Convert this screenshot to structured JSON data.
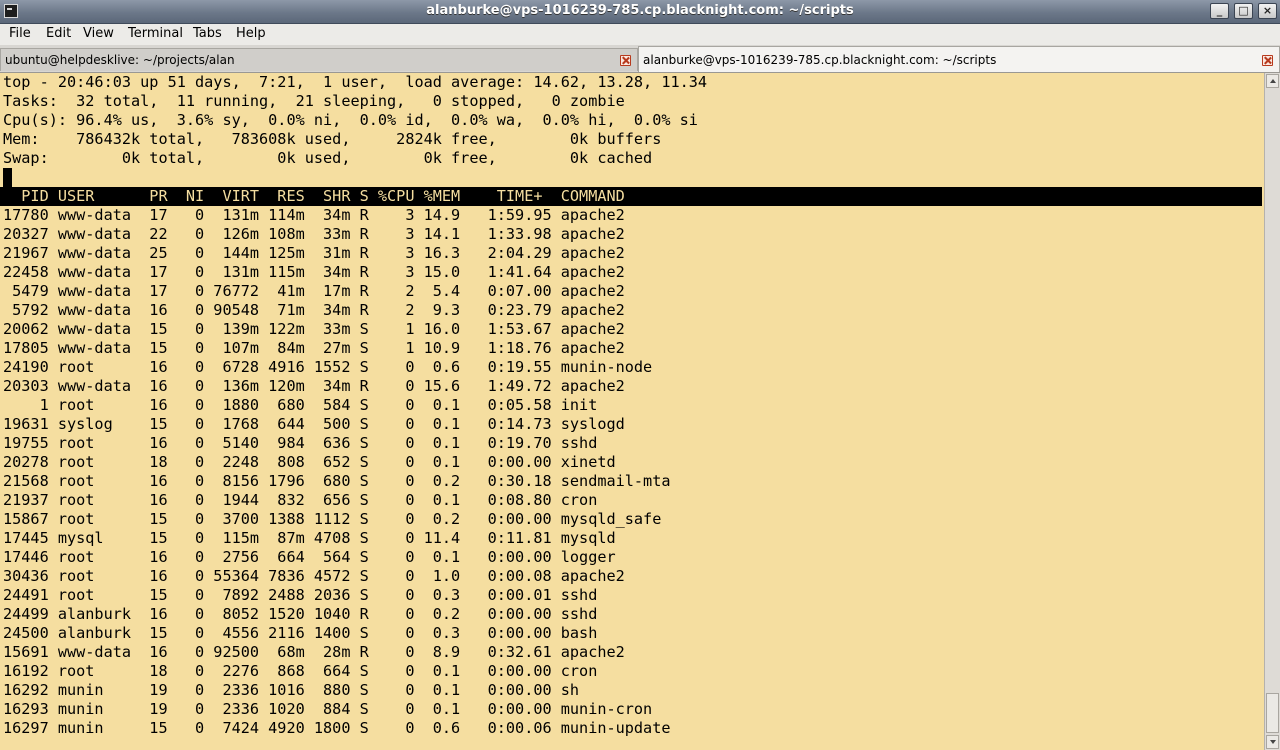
{
  "window": {
    "title": "alanburke@vps-1016239-785.cp.blacknight.com: ~/scripts",
    "minimize_label": "_",
    "maximize_label": "□",
    "close_label": "×"
  },
  "menu": [
    "File",
    "Edit",
    "View",
    "Terminal",
    "Tabs",
    "Help"
  ],
  "tabs": [
    {
      "label": "ubuntu@helpdesklive: ~/projects/alan",
      "active": false
    },
    {
      "label": "alanburke@vps-1016239-785.cp.blacknight.com: ~/scripts",
      "active": true
    }
  ],
  "summary": [
    "top - 20:46:03 up 51 days,  7:21,  1 user,  load average: 14.62, 13.28, 11.34",
    "Tasks:  32 total,  11 running,  21 sleeping,   0 stopped,   0 zombie",
    "Cpu(s): 96.4% us,  3.6% sy,  0.0% ni,  0.0% id,  0.0% wa,  0.0% hi,  0.0% si",
    "Mem:    786432k total,   783608k used,     2824k free,        0k buffers",
    "Swap:        0k total,        0k used,        0k free,        0k cached"
  ],
  "table_header": "  PID USER      PR  NI  VIRT  RES  SHR S %CPU %MEM    TIME+  COMMAND",
  "processes": [
    "17780 www-data  17   0  131m 114m  34m R    3 14.9   1:59.95 apache2",
    "20327 www-data  22   0  126m 108m  33m R    3 14.1   1:33.98 apache2",
    "21967 www-data  25   0  144m 125m  31m R    3 16.3   2:04.29 apache2",
    "22458 www-data  17   0  131m 115m  34m R    3 15.0   1:41.64 apache2",
    " 5479 www-data  17   0 76772  41m  17m R    2  5.4   0:07.00 apache2",
    " 5792 www-data  16   0 90548  71m  34m R    2  9.3   0:23.79 apache2",
    "20062 www-data  15   0  139m 122m  33m S    1 16.0   1:53.67 apache2",
    "17805 www-data  15   0  107m  84m  27m S    1 10.9   1:18.76 apache2",
    "24190 root      16   0  6728 4916 1552 S    0  0.6   0:19.55 munin-node",
    "20303 www-data  16   0  136m 120m  34m R    0 15.6   1:49.72 apache2",
    "    1 root      16   0  1880  680  584 S    0  0.1   0:05.58 init",
    "19631 syslog    15   0  1768  644  500 S    0  0.1   0:14.73 syslogd",
    "19755 root      16   0  5140  984  636 S    0  0.1   0:19.70 sshd",
    "20278 root      18   0  2248  808  652 S    0  0.1   0:00.00 xinetd",
    "21568 root      16   0  8156 1796  680 S    0  0.2   0:30.18 sendmail-mta",
    "21937 root      16   0  1944  832  656 S    0  0.1   0:08.80 cron",
    "15867 root      15   0  3700 1388 1112 S    0  0.2   0:00.00 mysqld_safe",
    "17445 mysql     15   0  115m  87m 4708 S    0 11.4   0:11.81 mysqld",
    "17446 root      16   0  2756  664  564 S    0  0.1   0:00.00 logger",
    "30436 root      16   0 55364 7836 4572 S    0  1.0   0:00.08 apache2",
    "24491 root      15   0  7892 2488 2036 S    0  0.3   0:00.01 sshd",
    "24499 alanburk  16   0  8052 1520 1040 R    0  0.2   0:00.00 sshd",
    "24500 alanburk  15   0  4556 2116 1400 S    0  0.3   0:00.00 bash",
    "15691 www-data  16   0 92500  68m  28m R    0  8.9   0:32.61 apache2",
    "16192 root      18   0  2276  868  664 S    0  0.1   0:00.00 cron",
    "16292 munin     19   0  2336 1016  880 S    0  0.1   0:00.00 sh",
    "16293 munin     19   0  2336 1020  884 S    0  0.1   0:00.00 munin-cron",
    "16297 munin     15   0  7424 4920 1800 S    0  0.6   0:00.06 munin-update"
  ],
  "colors": {
    "terminal_bg": "#f5dea0",
    "terminal_fg": "#000000",
    "titlebar": "#6c7889"
  }
}
